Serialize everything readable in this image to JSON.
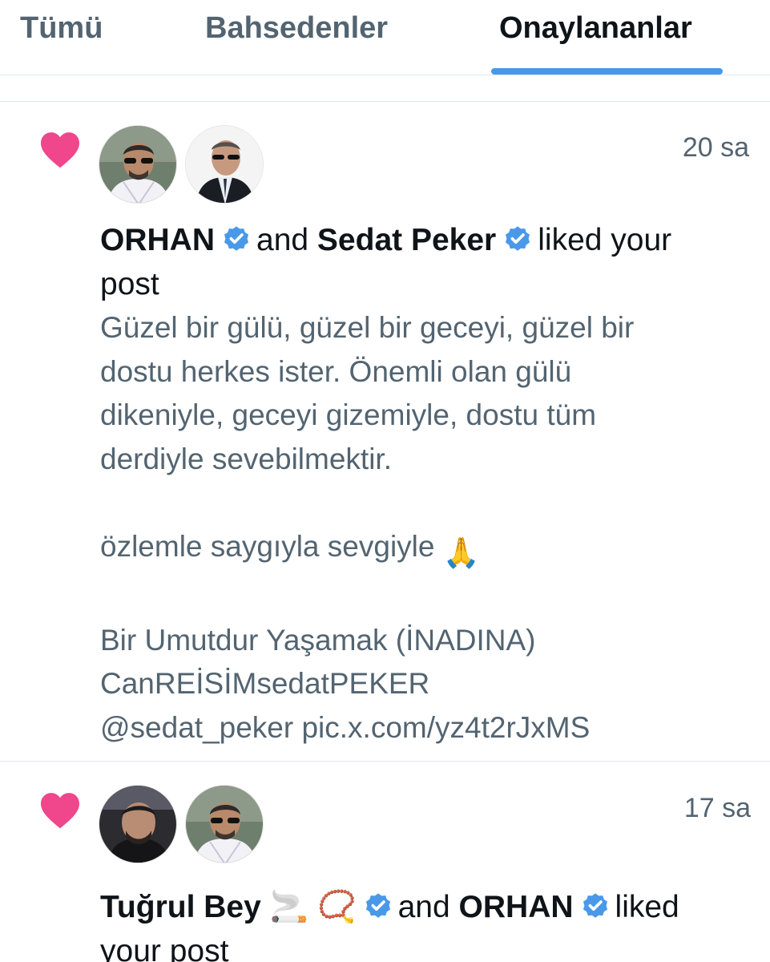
{
  "tabs": {
    "all": "Tümü",
    "mentions": "Bahsedenler",
    "verified": "Onaylananlar",
    "active": "verified"
  },
  "colors": {
    "accent": "#4a99e9",
    "heart": "#f0468b",
    "verified_badge": "#4a99e9",
    "secondary_text": "#536471"
  },
  "notifications": [
    {
      "type": "like",
      "icon": "heart-icon",
      "timestamp": "20 sa",
      "user1": "ORHAN",
      "user2": "Sedat Peker",
      "connector": "and",
      "action_line1": "liked your",
      "action_line2": "post",
      "post_text": "Güzel bir gülü, güzel bir geceyi, güzel bir\ndostu herkes ister. Önemli olan gülü\ndikeniyle, geceyi gizemiyle, dostu tüm\nderdiyle sevebilmektir.\n\nözlemle saygıyla sevgiyle",
      "post_emoji": "🙏",
      "post_text_2": "\n\nBir Umutdur Yaşamak (İNADINA)\nCanREİSİMsedatPEKER\n@sedat_peker pic.x.com/yz4t2rJxMS"
    },
    {
      "type": "like",
      "icon": "heart-icon",
      "timestamp": "17 sa",
      "user1": "Tuğrul Bey",
      "user1_emoji": "🚬 📿",
      "user2": "ORHAN",
      "connector": "and",
      "action_line1": "liked",
      "action_line2": "your post"
    }
  ]
}
